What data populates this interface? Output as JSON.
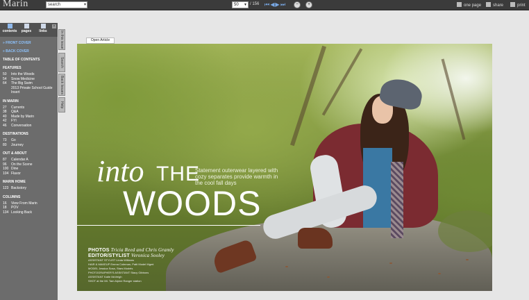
{
  "toolbar": {
    "logo": "Marin",
    "search_value": "search",
    "page_value": "50",
    "page_total": "/ 156",
    "one_page": "one page",
    "share": "share",
    "print": "print"
  },
  "sidebar": {
    "tabs": [
      {
        "label": "contents"
      },
      {
        "label": "pages"
      },
      {
        "label": "links"
      }
    ],
    "front_cover": "» FRONT COVER",
    "back_cover": "» BACK COVER",
    "toc_title": "TABLE OF CONTENTS",
    "sections": [
      {
        "title": "FEATURES",
        "items": [
          {
            "page": "50",
            "label": "Into the Woods"
          },
          {
            "page": "54",
            "label": "Snow Medicine"
          },
          {
            "page": "64",
            "label": "The Big Swim"
          },
          {
            "page": "68",
            "label": "2013 Private School Guide Insert"
          }
        ]
      },
      {
        "title": "IN MARIN",
        "items": [
          {
            "page": "27",
            "label": "Currents"
          },
          {
            "page": "38",
            "label": "Q&A"
          },
          {
            "page": "40",
            "label": "Made by Marin"
          },
          {
            "page": "42",
            "label": "FYI"
          },
          {
            "page": "46",
            "label": "Conversation"
          }
        ]
      },
      {
        "title": "DESTINATIONS",
        "items": [
          {
            "page": "73",
            "label": "Go"
          },
          {
            "page": "80",
            "label": "Journey"
          }
        ]
      },
      {
        "title": "OUT & ABOUT",
        "items": [
          {
            "page": "87",
            "label": "Calendar A"
          },
          {
            "page": "96",
            "label": "On the Scene"
          },
          {
            "page": "100",
            "label": "Dine"
          },
          {
            "page": "104",
            "label": "Flavor"
          }
        ]
      },
      {
        "title": "MARIN HOME",
        "items": [
          {
            "page": "123",
            "label": "Backstory"
          }
        ]
      },
      {
        "title": "COLUMNS",
        "items": [
          {
            "page": "16",
            "label": "View From Marin"
          },
          {
            "page": "18",
            "label": "POV"
          },
          {
            "page": "134",
            "label": "Looking Back"
          }
        ]
      }
    ]
  },
  "vtabs": [
    "In this issue",
    "Search",
    "Back Issues",
    "Help"
  ],
  "article": {
    "open_article": "Open Article",
    "title_into": "into",
    "title_the": "THE",
    "title_woods": "WOODS",
    "tagline": "Statement outerwear layered with cozy separates provide warmth in the cool fall days",
    "photos_label": "PHOTOS",
    "photos_names": "Tricia Reed and Chris Gramly",
    "editor_label": "EDITOR/STYLIST",
    "editor_name": "Veronica Sooley",
    "small_credits": [
      "ASSISTANT STYLIST Linda Williams",
      "HAIR & MAKEUP Emma Coleman, Patti Model Mgmt",
      "MODEL Jessica Sosa, Stars Models",
      "PHOTOGRAPHER'S ASSISTANT Stacy Gibbons",
      "ASSISTANT Katie McVeigh",
      "SHOT at the Mt. Tam Alpine Ranger station"
    ]
  }
}
